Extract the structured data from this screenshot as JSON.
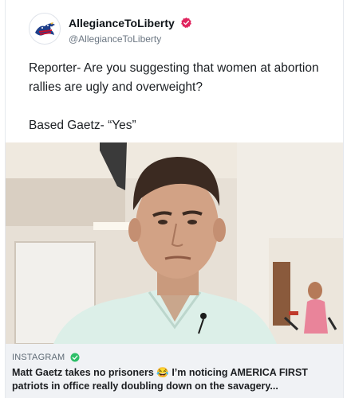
{
  "post": {
    "display_name": "AllegianceToLiberty",
    "handle": "@AllegianceToLiberty",
    "text_line1": "Reporter- Are you suggesting that women at abortion rallies are ugly and overweight?",
    "text_line2": "Based Gaetz- “Yes”"
  },
  "link_preview": {
    "source": "INSTAGRAM",
    "caption": "Matt Gaetz takes no prisoners 😂 I’m noticing AMERICA FIRST patriots in office really doubling down on the savagery..."
  },
  "colors": {
    "verified_badge": "#e0245e",
    "source_check": "#2dbf68"
  },
  "icons": {
    "avatar": "eagle-flag-logo",
    "verified": "verified-badge-icon",
    "source_check": "check-circle-icon"
  }
}
